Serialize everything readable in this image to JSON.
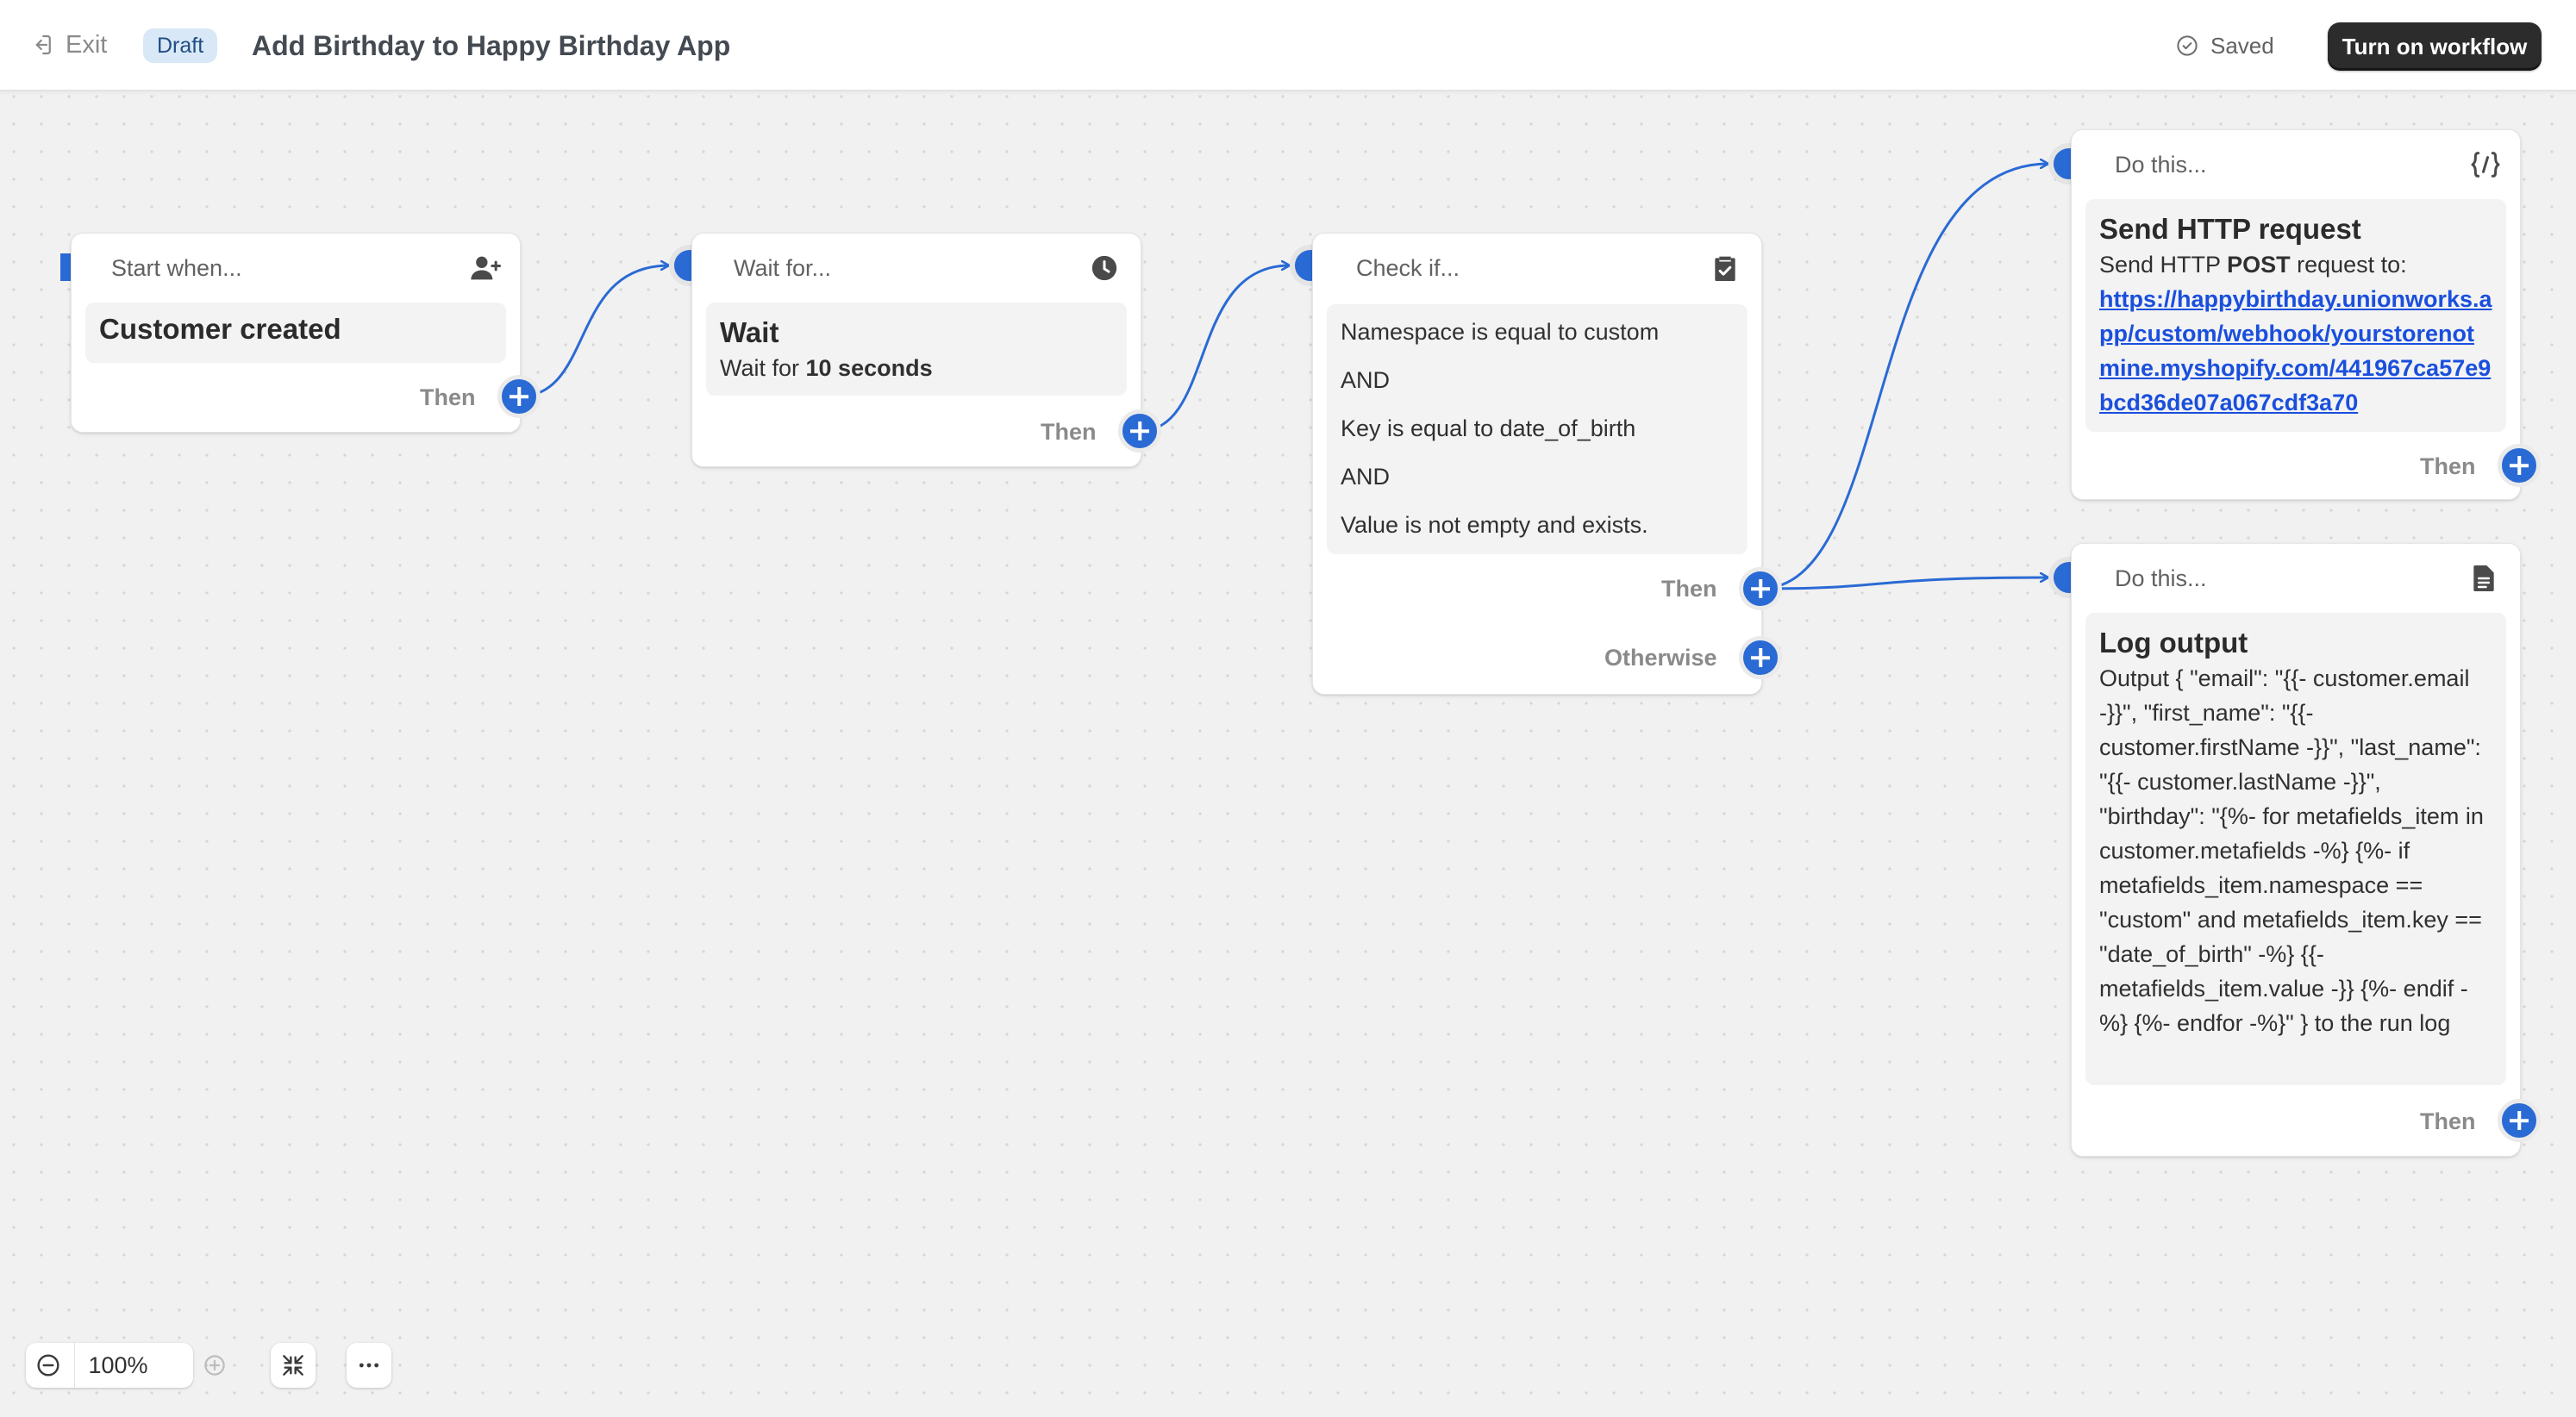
{
  "header": {
    "exit_label": "Exit",
    "status_badge": "Draft",
    "title": "Add Birthday to Happy Birthday App",
    "saved_label": "Saved",
    "primary_button": "Turn on workflow"
  },
  "nodes": {
    "trigger": {
      "header": "Start when...",
      "icon": "person-add-icon",
      "title": "Customer created",
      "then": "Then"
    },
    "wait": {
      "header": "Wait for...",
      "icon": "clock-icon",
      "title": "Wait",
      "text_prefix": "Wait for ",
      "text_bold": "10 seconds",
      "then": "Then"
    },
    "condition": {
      "header": "Check if...",
      "icon": "clipboard-check-icon",
      "rows": [
        "Namespace is equal to custom",
        "AND",
        "Key is equal to date_of_birth",
        "AND",
        "Value is not empty and exists."
      ],
      "then": "Then",
      "otherwise": "Otherwise"
    },
    "http_action": {
      "header": "Do this...",
      "icon": "code-icon",
      "title": "Send HTTP request",
      "text_prefix": "Send HTTP ",
      "text_bold": "POST",
      "text_suffix": " request to:",
      "url": "https://happybirthday.unionworks.app/custom/webhook/yourstorenotmine.myshopify.com/441967ca57e9bcd36de07a067cdf3a70",
      "then": "Then"
    },
    "log_action": {
      "header": "Do this...",
      "icon": "document-icon",
      "title": "Log output",
      "text": "Output { \"email\": \"{{- customer.email -}}\", \"first_name\": \"{{- customer.firstName -}}\", \"last_name\": \"{{- customer.lastName -}}\", \"birthday\": \"{%- for metafields_item in customer.metafields -%} {%- if metafields_item.namespace == \"custom\" and metafields_item.key == \"date_of_birth\" -%} {{- metafields_item.value -}} {%- endif -%} {%- endfor -%}\" } to the run log",
      "then": "Then"
    }
  },
  "canvas_controls": {
    "zoom": "100%"
  },
  "colors": {
    "accent": "#2a6ad4",
    "link": "#1a4fdd",
    "badge_bg": "#d9e8f7",
    "primary_button_bg": "#2c2c2c"
  }
}
